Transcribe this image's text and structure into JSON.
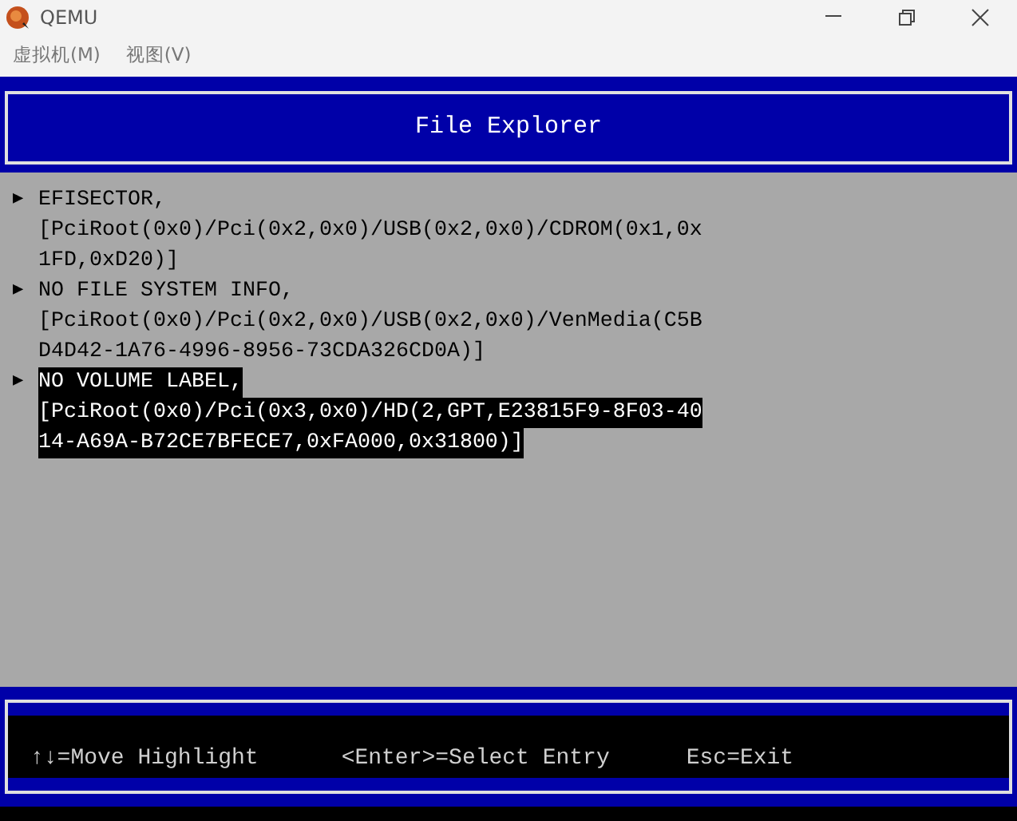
{
  "window": {
    "title": "QEMU"
  },
  "menu": [
    "虚拟机(M)",
    "视图(V)"
  ],
  "header": {
    "title": "File Explorer"
  },
  "entries": [
    {
      "marker": "▶",
      "lines": [
        "EFISECTOR,",
        "[PciRoot(0x0)/Pci(0x2,0x0)/USB(0x2,0x0)/CDROM(0x1,0x",
        "1FD,0xD20)]"
      ],
      "selected": false
    },
    {
      "marker": "▶",
      "lines": [
        "NO FILE SYSTEM INFO,",
        "[PciRoot(0x0)/Pci(0x2,0x0)/USB(0x2,0x0)/VenMedia(C5B",
        "D4D42-1A76-4996-8956-73CDA326CD0A)]"
      ],
      "selected": false
    },
    {
      "marker": "▶",
      "lines": [
        "NO VOLUME LABEL,",
        "[PciRoot(0x0)/Pci(0x3,0x0)/HD(2,GPT,E23815F9-8F03-40",
        "14-A69A-B72CE7BFECE7,0xFA000,0x31800)]"
      ],
      "selected": true
    }
  ],
  "footer": [
    "↑↓=Move Highlight",
    "<Enter>=Select Entry",
    "Esc=Exit"
  ]
}
